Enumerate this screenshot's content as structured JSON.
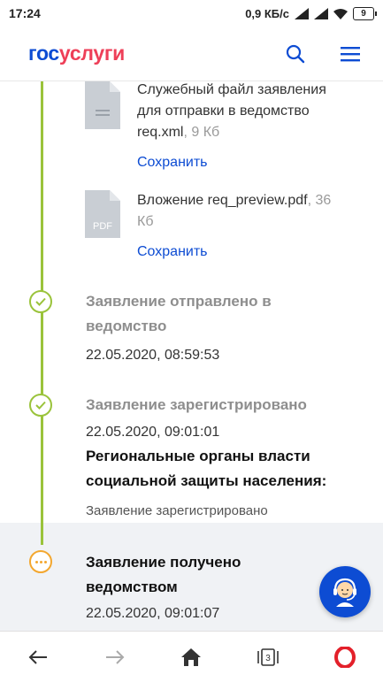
{
  "status_bar": {
    "time": "17:24",
    "network_speed": "0,9 КБ/с",
    "battery": "9"
  },
  "header": {
    "logo_part1": "гос",
    "logo_part2": "услуги",
    "icons": [
      "search-icon",
      "menu-icon"
    ]
  },
  "files": [
    {
      "name": "Служебный файл заявления для отправки в ведомство req.xml",
      "size": ", 9 Кб",
      "icon_label": "",
      "save": "Сохранить"
    },
    {
      "name": "Вложение req_preview.pdf",
      "size": ", 36 Кб",
      "icon_label": "PDF",
      "save": "Сохранить"
    }
  ],
  "events": [
    {
      "title": "Заявление отправлено в ведомство",
      "date": "22.05.2020, 08:59:53"
    },
    {
      "title": "Заявление зарегистрировано",
      "date": "22.05.2020, 09:01:01",
      "org": "Региональные органы власти социальной защиты населения:",
      "org_status": "Заявление зарегистрировано"
    },
    {
      "title": "Заявление получено ведомством",
      "date": "22.05.2020, 09:01:07"
    }
  ],
  "bottom_nav": {
    "tabs_count": "3"
  },
  "colors": {
    "accent": "#0d4cd3",
    "logo_red": "#ee3f58",
    "timeline_done": "#9ac33b",
    "timeline_pending": "#f3a72f"
  }
}
